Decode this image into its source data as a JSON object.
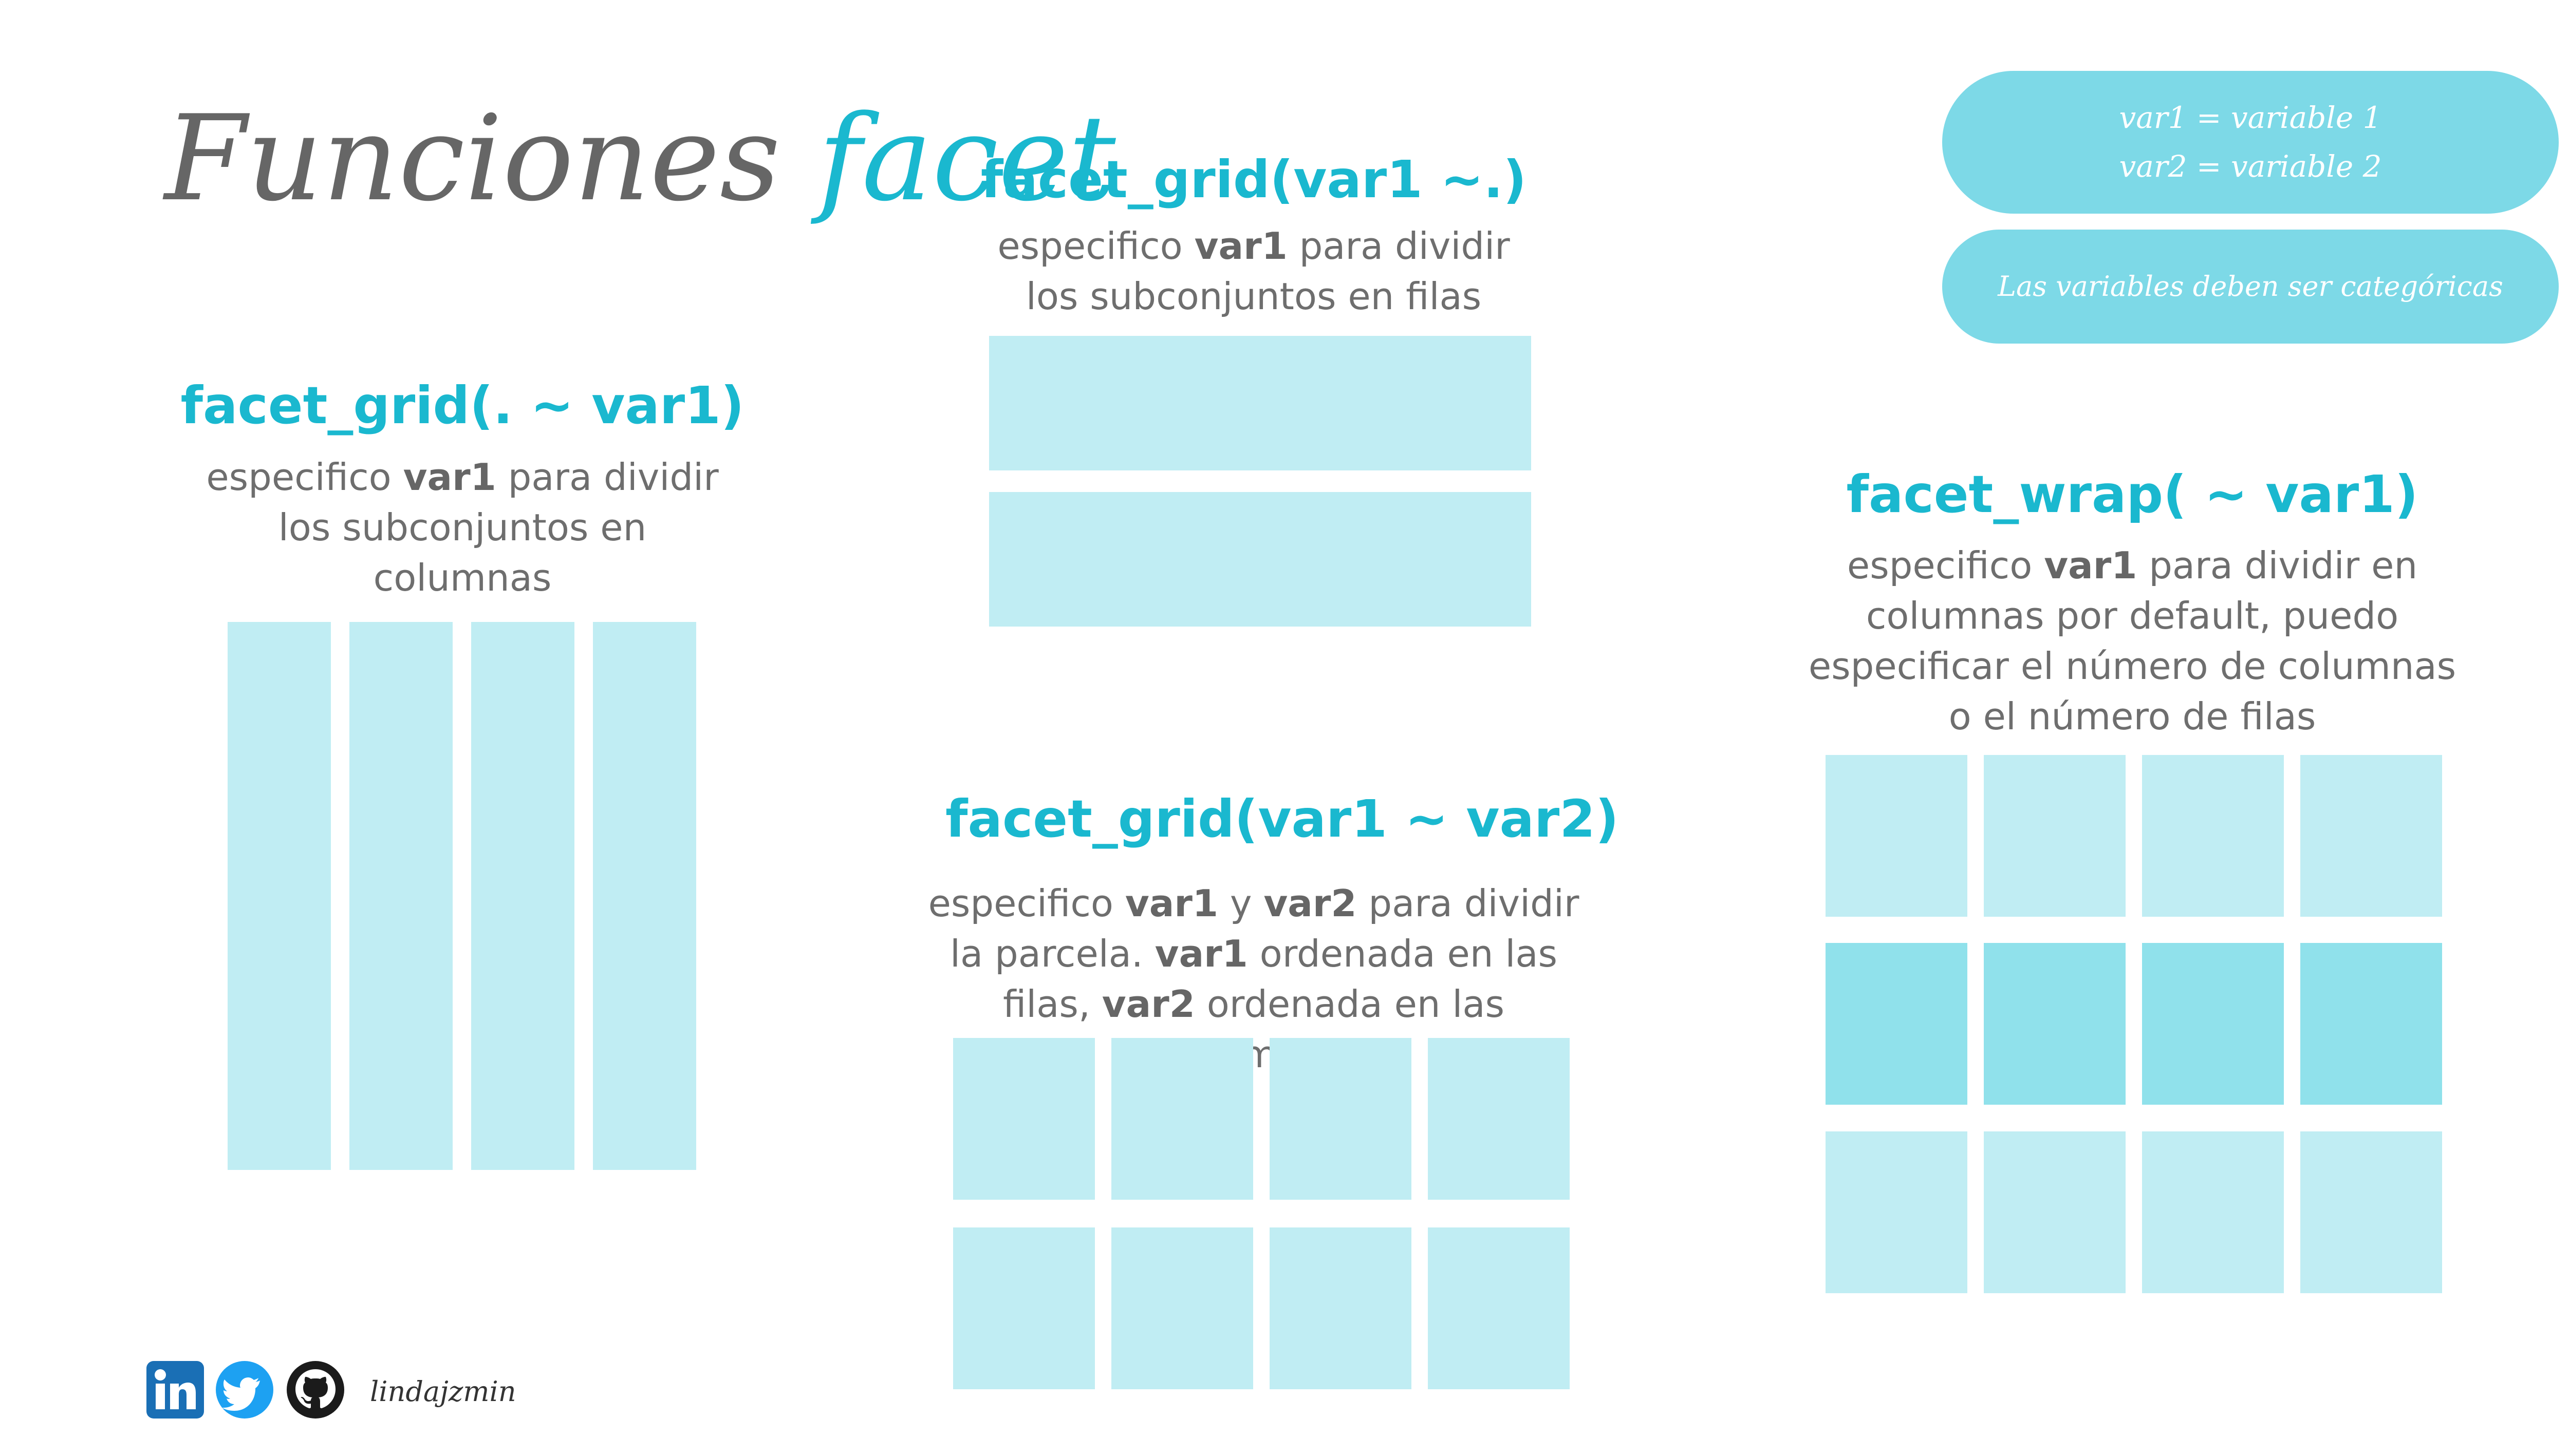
{
  "title": {
    "part1": "Funciones",
    "part2": "facet"
  },
  "legend": {
    "line1": "var1 = variable 1",
    "line2": "var2 = variable 2",
    "note": "Las variables deben ser categóricas"
  },
  "cols": {
    "heading": "facet_grid(. ~ var1)",
    "desc_pre": "especifico ",
    "desc_bold": "var1",
    "desc_post": " para dividir los subconjuntos en columnas"
  },
  "rows": {
    "heading": "facet_grid(var1 ~.)",
    "desc_pre": "especifico ",
    "desc_bold": "var1",
    "desc_post": " para dividir los subconjuntos en filas"
  },
  "grid": {
    "heading": "facet_grid(var1 ~ var2)",
    "t1": "especifico ",
    "b1": "var1",
    "t2": " y ",
    "b2": "var2",
    "t3": " para dividir la parcela. ",
    "b3": "var1",
    "t4": " ordenada en las filas, ",
    "b4": "var2",
    "t5": " ordenada en las columnas"
  },
  "wrap": {
    "heading": "facet_wrap( ~ var1)",
    "desc_pre": "especifico ",
    "desc_bold": "var1",
    "desc_post": " para dividir en columnas por default, puedo especificar el número de columnas o el número de filas"
  },
  "footer": {
    "handle": "lindajzmin"
  },
  "colors": {
    "accent": "#1ab8cf",
    "panel": "#c0edf3",
    "panel_dark": "#90e1eb",
    "pill": "#7dd9e7"
  }
}
